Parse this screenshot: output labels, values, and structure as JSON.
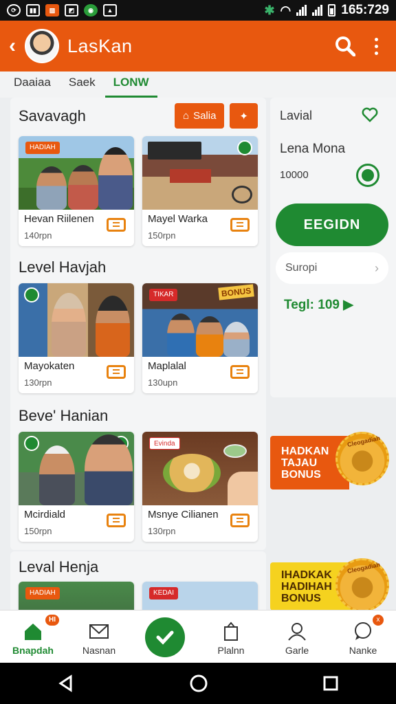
{
  "status_bar": {
    "time": "165:729",
    "left_icons": [
      "sync-icon",
      "gallery-icon",
      "photo-icon",
      "image-icon",
      "app-icon",
      "flag-icon"
    ],
    "right_icons": [
      "network-icon",
      "wifi-icon",
      "signal-icon",
      "signal-icon",
      "battery-icon"
    ]
  },
  "app_bar": {
    "title": "LasKan",
    "actions": [
      "search-icon",
      "more-vert-icon"
    ]
  },
  "tabs": [
    {
      "label": "Daaiaa",
      "active": false
    },
    {
      "label": "Saek",
      "active": false
    },
    {
      "label": "LONW",
      "active": true
    }
  ],
  "main": {
    "sections": [
      {
        "title": "Savavagh",
        "buttons": {
          "sale_label": "Salia"
        },
        "cards": [
          {
            "name": "Hevan Riilenen",
            "price": "140rpn",
            "tag": "HADIAH"
          },
          {
            "name": "Mayel Warka",
            "price": "150rpn"
          }
        ]
      },
      {
        "title": "Level Havjah",
        "cards": [
          {
            "name": "Mayokaten",
            "price": "130rpn"
          },
          {
            "name": "Maplalal",
            "price": "130upn",
            "tag": "TIKAR",
            "overlay": "BONUS"
          }
        ]
      },
      {
        "title": "Beve' Hanian",
        "cards": [
          {
            "name": "Mcirdiald",
            "price": "150rpn"
          },
          {
            "name": "Msnye Cilianen",
            "price": "130rpn",
            "tag": "Evinda"
          }
        ]
      },
      {
        "title": "Leval Henja",
        "cards": [
          {
            "tag": "HADIAH"
          },
          {
            "tag": "KEDAI"
          }
        ]
      }
    ]
  },
  "side": {
    "label1": "Lavial",
    "name": "Lena Mona",
    "amount": "10000",
    "primary_button": "EEGIDN",
    "select_value": "Suropi",
    "tegl": "Tegl: 109",
    "accent": "#1f8a32"
  },
  "promos": [
    {
      "text": "HADKAN TAJAU BONUS",
      "seal": "Cleogadiah",
      "bg": "#e8580f",
      "fg": "#ffffff"
    },
    {
      "text": "IHADKAK HADIHAH BONUS",
      "seal": "Cleogadiah",
      "bg": "#f5d21f",
      "fg": "#4a2a00"
    }
  ],
  "bottom_nav": [
    {
      "label": "Bnapdah",
      "icon": "home-icon",
      "active": true,
      "badge": "HI"
    },
    {
      "label": "Nasnan",
      "icon": "mail-icon",
      "active": false
    },
    {
      "label": "",
      "icon": "check-icon",
      "active": false
    },
    {
      "label": "Plalnn",
      "icon": "bag-icon",
      "active": false
    },
    {
      "label": "Garle",
      "icon": "person-icon",
      "active": false
    },
    {
      "label": "Nanke",
      "icon": "chat-icon",
      "active": false,
      "badge": "x"
    }
  ],
  "system_nav": [
    "back-icon",
    "home-circle-icon",
    "recents-icon"
  ],
  "colors": {
    "brand": "#e8580f",
    "accent": "#1f8a32"
  }
}
